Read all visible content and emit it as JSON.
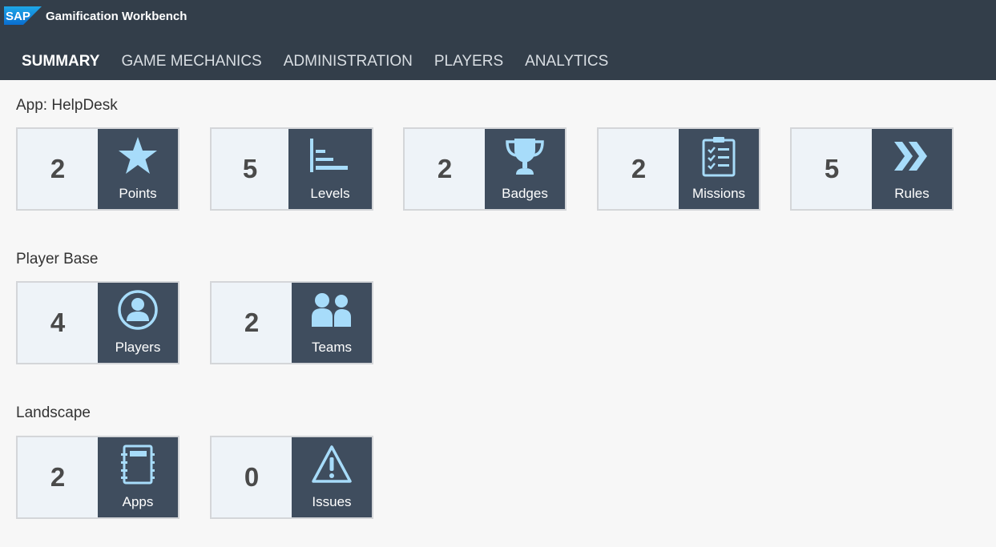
{
  "shell": {
    "logo_text": "SAP",
    "app_title": "Gamification Workbench"
  },
  "nav": {
    "tabs": [
      {
        "label": "SUMMARY",
        "active": true
      },
      {
        "label": "GAME MECHANICS",
        "active": false
      },
      {
        "label": "ADMINISTRATION",
        "active": false
      },
      {
        "label": "PLAYERS",
        "active": false
      },
      {
        "label": "ANALYTICS",
        "active": false
      }
    ]
  },
  "sections": [
    {
      "title": "App: HelpDesk",
      "tiles": [
        {
          "count": "2",
          "label": "Points",
          "icon": "star-icon"
        },
        {
          "count": "5",
          "label": "Levels",
          "icon": "levels-icon"
        },
        {
          "count": "2",
          "label": "Badges",
          "icon": "trophy-icon"
        },
        {
          "count": "2",
          "label": "Missions",
          "icon": "clipboard-checklist-icon"
        },
        {
          "count": "5",
          "label": "Rules",
          "icon": "double-chevron-icon"
        }
      ]
    },
    {
      "title": "Player Base",
      "tiles": [
        {
          "count": "4",
          "label": "Players",
          "icon": "person-circle-icon"
        },
        {
          "count": "2",
          "label": "Teams",
          "icon": "group-icon"
        }
      ]
    },
    {
      "title": "Landscape",
      "tiles": [
        {
          "count": "2",
          "label": "Apps",
          "icon": "notebook-icon"
        },
        {
          "count": "0",
          "label": "Issues",
          "icon": "warning-triangle-icon"
        }
      ]
    }
  ],
  "colors": {
    "shell_bg": "#333e4a",
    "tile_panel": "#3f4d5e",
    "tile_count_bg": "#eef3f8",
    "icon_color": "#a7dcfa",
    "page_bg": "#f7f7f7"
  }
}
